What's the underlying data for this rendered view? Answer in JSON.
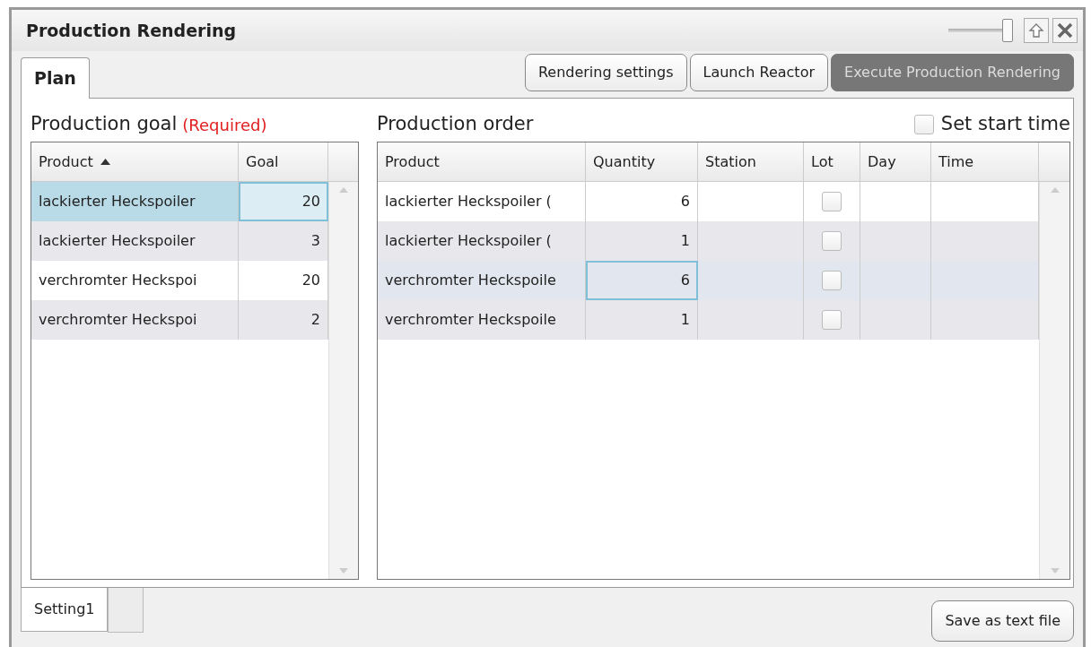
{
  "window": {
    "title": "Production Rendering",
    "zoom_slider": {
      "level": 1
    }
  },
  "tabs": [
    {
      "label": "Plan",
      "selected": true
    }
  ],
  "toolbar_buttons": [
    {
      "label": "Rendering settings",
      "disabled": false
    },
    {
      "label": "Launch Reactor",
      "disabled": false
    },
    {
      "label": "Execute Production Rendering",
      "disabled": true
    }
  ],
  "production_goal": {
    "title": "Production goal",
    "required_note": "(Required)",
    "columns": [
      {
        "label": "Product",
        "sorted": true
      },
      {
        "label": "Goal",
        "sorted": false
      }
    ],
    "rows": [
      {
        "product": "lackierter Heckspoiler",
        "goal": "20",
        "selected": true
      },
      {
        "product": "lackierter Heckspoiler",
        "goal": "3",
        "selected": false
      },
      {
        "product": "verchromter Heckspoi",
        "goal": "20",
        "selected": false
      },
      {
        "product": "verchromter Heckspoi",
        "goal": "2",
        "selected": false
      }
    ]
  },
  "production_order": {
    "title": "Production order",
    "set_start_time": {
      "label": "Set start time",
      "checked": false
    },
    "columns": [
      "Product",
      "Quantity",
      "Station",
      "Lot",
      "Day",
      "Time"
    ],
    "rows": [
      {
        "product": "lackierter Heckspoiler (",
        "quantity": "6",
        "lot": false,
        "selected": false
      },
      {
        "product": "lackierter Heckspoiler (",
        "quantity": "1",
        "lot": false,
        "selected": false
      },
      {
        "product": "verchromter Heckspoile",
        "quantity": "6",
        "lot": false,
        "selected": true
      },
      {
        "product": "verchromter Heckspoile",
        "quantity": "1",
        "lot": false,
        "selected": false
      }
    ]
  },
  "bottom_tabs": [
    {
      "label": "Setting1",
      "selected": true
    }
  ],
  "save_button": "Save as text file"
}
